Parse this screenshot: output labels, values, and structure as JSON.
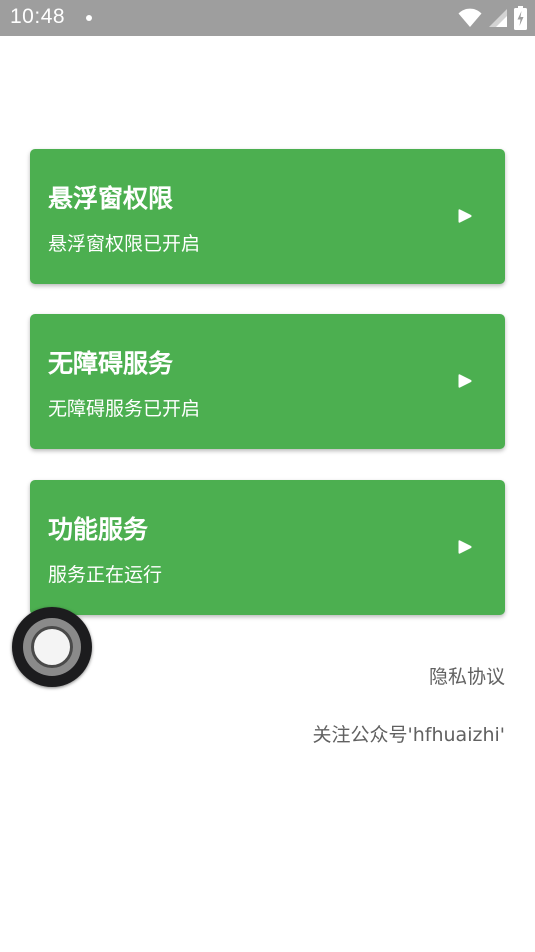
{
  "status_bar": {
    "time": "10:48",
    "icons": [
      "notification-dot-icon",
      "wifi-icon",
      "cellular-signal-icon",
      "battery-charging-icon"
    ]
  },
  "cards": [
    {
      "title": "悬浮窗权限",
      "subtitle": "悬浮窗权限已开启",
      "icon": "play-arrow-icon"
    },
    {
      "title": "无障碍服务",
      "subtitle": "无障碍服务已开启",
      "icon": "play-arrow-icon"
    },
    {
      "title": "功能服务",
      "subtitle": "服务正在运行",
      "icon": "play-arrow-icon"
    }
  ],
  "links": {
    "privacy": "隐私协议",
    "follow": "关注公众号'hfhuaizhi'"
  },
  "colors": {
    "status_bar_bg": "#9e9e9e",
    "card_bg": "#4caf50",
    "text_on_card": "#ffffff",
    "link_text": "#616161"
  }
}
